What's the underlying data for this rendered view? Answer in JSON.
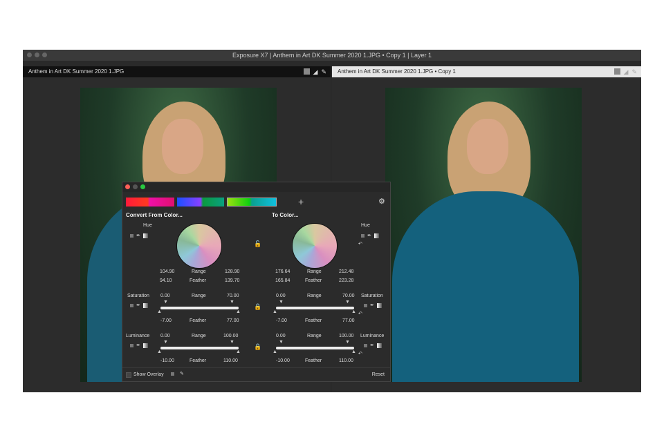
{
  "window": {
    "title": "Exposure X7 | Anthem in Art DK Summer 2020 1.JPG • Copy 1 | Layer 1"
  },
  "panes": [
    {
      "title": "Anthem in Art DK Summer 2020 1.JPG"
    },
    {
      "title": "Anthem in Art DK Summer 2020 1.JPG • Copy 1"
    }
  ],
  "dialog": {
    "swatch_colors": [
      [
        "#ff1a3a",
        "#ff3a20",
        "#ee10a8"
      ],
      [
        "#1a50ff",
        "#8a40ff",
        "#0a9a40",
        "#0aa080"
      ],
      [
        "#9ae010",
        "#10d010",
        "#0aa090",
        "#10c0e0"
      ]
    ],
    "add_label": "+",
    "from_title": "Convert From Color...",
    "to_title": "To Color...",
    "hue": "Hue",
    "saturation": "Saturation",
    "luminance": "Luminance",
    "range": "Range",
    "feather": "Feather",
    "from": {
      "hue": {
        "r1": "104.90",
        "r2": "128.90",
        "f1": "94.10",
        "f2": "139.70"
      },
      "sat": {
        "r1": "0.00",
        "r2": "70.00",
        "f1": "-7.00",
        "f2": "77.00"
      },
      "lum": {
        "r1": "0.00",
        "r2": "100.00",
        "f1": "-10.00",
        "f2": "110.00"
      }
    },
    "to": {
      "hue": {
        "r1": "176.64",
        "r2": "212.48",
        "f1": "165.84",
        "f2": "223.28"
      },
      "sat": {
        "r1": "0.00",
        "r2": "70.00",
        "f1": "-7.00",
        "f2": "77.00"
      },
      "lum": {
        "r1": "0.00",
        "r2": "100.00",
        "f1": "-10.00",
        "f2": "110.00"
      }
    },
    "show_overlay": "Show Overlay",
    "reset": "Reset"
  }
}
